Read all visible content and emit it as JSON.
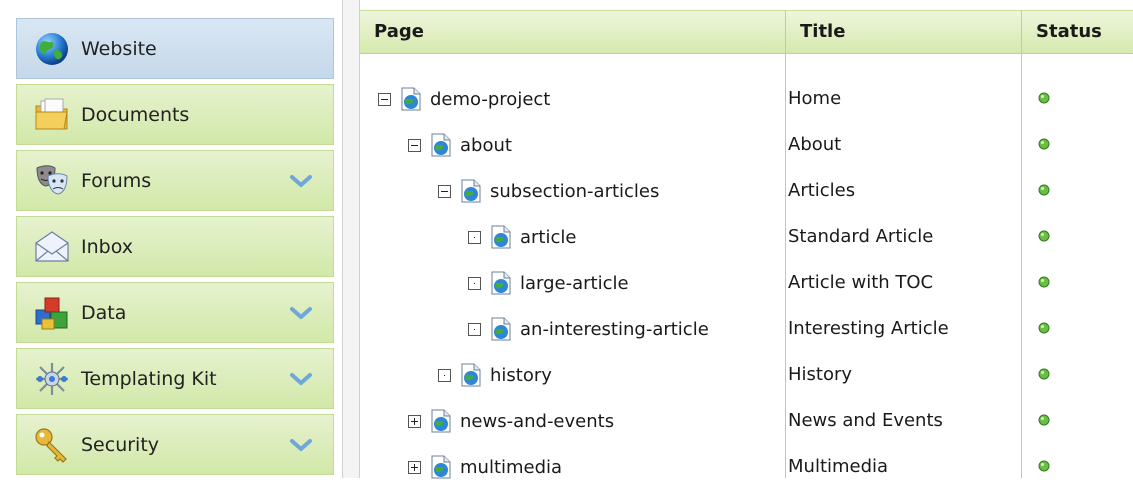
{
  "colors": {
    "nav_green": "#d2e8a8",
    "nav_active_blue": "#c5d8ea",
    "header_green": "#d6e9ae",
    "status_ok": "#6cbd45"
  },
  "sidebar": {
    "items": [
      {
        "label": "Website",
        "icon": "globe-icon",
        "active": true,
        "expandable": false
      },
      {
        "label": "Documents",
        "icon": "folder-icon",
        "active": false,
        "expandable": false
      },
      {
        "label": "Forums",
        "icon": "theater-masks-icon",
        "active": false,
        "expandable": true
      },
      {
        "label": "Inbox",
        "icon": "envelope-icon",
        "active": false,
        "expandable": false
      },
      {
        "label": "Data",
        "icon": "data-blocks-icon",
        "active": false,
        "expandable": true
      },
      {
        "label": "Templating Kit",
        "icon": "templating-kit-icon",
        "active": false,
        "expandable": true
      },
      {
        "label": "Security",
        "icon": "key-icon",
        "active": false,
        "expandable": true
      }
    ]
  },
  "tree": {
    "columns": {
      "page": "Page",
      "title": "Title",
      "status": "Status"
    },
    "rows": [
      {
        "page": "demo-project",
        "title": "Home",
        "level": 0,
        "toggle": "minus",
        "status": "published"
      },
      {
        "page": "about",
        "title": "About",
        "level": 1,
        "toggle": "minus",
        "status": "published"
      },
      {
        "page": "subsection-articles",
        "title": "Articles",
        "level": 2,
        "toggle": "minus",
        "status": "published"
      },
      {
        "page": "article",
        "title": "Standard Article",
        "level": 3,
        "toggle": "leaf",
        "status": "published"
      },
      {
        "page": "large-article",
        "title": "Article with TOC",
        "level": 3,
        "toggle": "leaf",
        "status": "published"
      },
      {
        "page": "an-interesting-article",
        "title": "Interesting Article",
        "level": 3,
        "toggle": "leaf",
        "status": "published"
      },
      {
        "page": "history",
        "title": "History",
        "level": 2,
        "toggle": "leaf",
        "status": "published"
      },
      {
        "page": "news-and-events",
        "title": "News and Events",
        "level": 1,
        "toggle": "plus",
        "status": "published"
      },
      {
        "page": "multimedia",
        "title": "Multimedia",
        "level": 1,
        "toggle": "plus",
        "status": "published"
      }
    ]
  }
}
